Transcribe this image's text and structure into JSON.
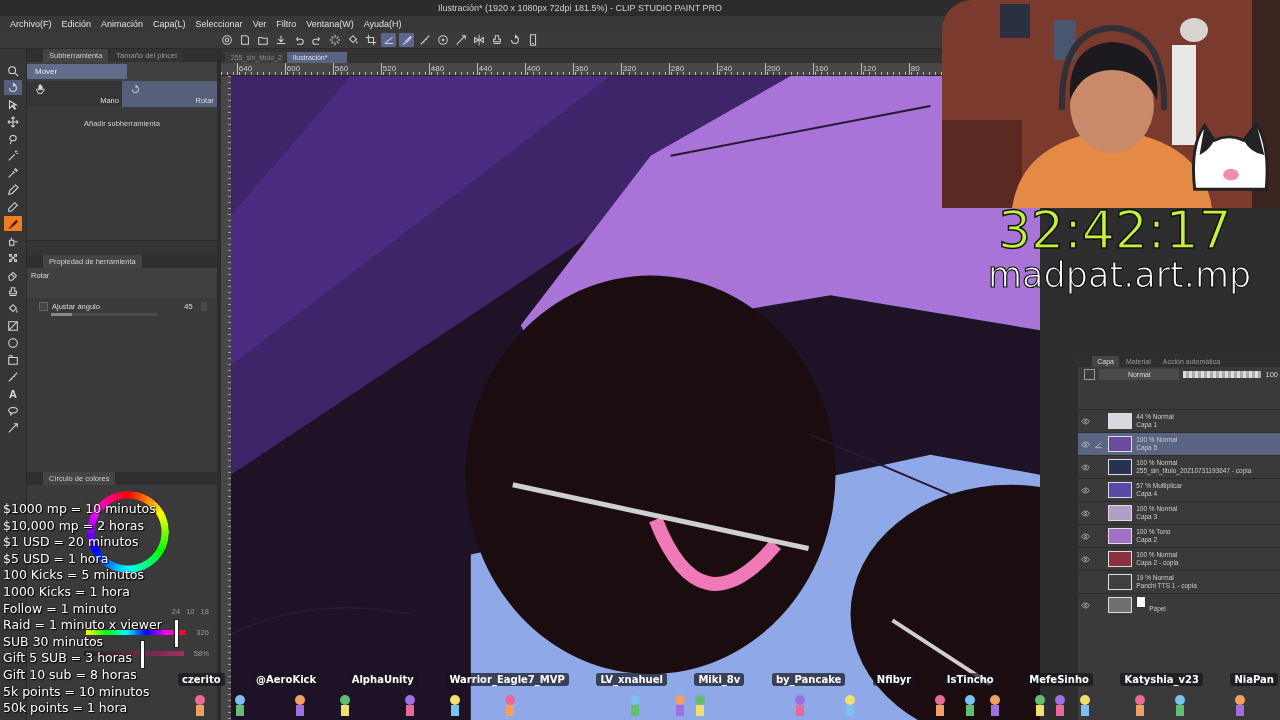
{
  "window": {
    "title": "Ilustración* (1920 x 1080px 72dpi 181.5%)  - CLIP STUDIO PAINT PRO"
  },
  "menu": [
    "Archivo(F)",
    "Edición",
    "Animación",
    "Capa(L)",
    "Seleccionar",
    "Ver",
    "Filtro",
    "Ventana(W)",
    "Ayuda(H)"
  ],
  "toolbar": [
    {
      "kind": "navigator",
      "on": false
    },
    {
      "kind": "new",
      "on": false
    },
    {
      "kind": "open",
      "on": false
    },
    {
      "kind": "save",
      "on": false
    },
    {
      "kind": "undo",
      "on": false
    },
    {
      "kind": "redo",
      "on": false
    },
    {
      "kind": "deselect",
      "on": false
    },
    {
      "kind": "fill",
      "on": false
    },
    {
      "kind": "crop",
      "on": false
    },
    {
      "kind": "snap",
      "on": true
    },
    {
      "kind": "brush",
      "on": true
    },
    {
      "kind": "ruler",
      "on": false
    },
    {
      "kind": "help",
      "on": false
    },
    {
      "kind": "correction",
      "on": false
    },
    {
      "kind": "flip",
      "on": false
    },
    {
      "kind": "stamp",
      "on": false
    },
    {
      "kind": "rotate",
      "on": false
    },
    {
      "kind": "device",
      "on": false
    }
  ],
  "tools": [
    {
      "kind": "zoom",
      "selected": false,
      "marked": false
    },
    {
      "kind": "rotate",
      "selected": true,
      "marked": false
    },
    {
      "kind": "select",
      "selected": false,
      "marked": false
    },
    {
      "kind": "move",
      "selected": false,
      "marked": false
    },
    {
      "kind": "lasso",
      "selected": false,
      "marked": false
    },
    {
      "kind": "wand",
      "selected": false,
      "marked": false
    },
    {
      "kind": "eyedropper",
      "selected": false,
      "marked": false
    },
    {
      "kind": "pen",
      "selected": false,
      "marked": false
    },
    {
      "kind": "pencil",
      "selected": false,
      "marked": false
    },
    {
      "kind": "brush",
      "selected": false,
      "marked": true
    },
    {
      "kind": "airbrush",
      "selected": false,
      "marked": false
    },
    {
      "kind": "decoration",
      "selected": false,
      "marked": false
    },
    {
      "kind": "eraser",
      "selected": false,
      "marked": false
    },
    {
      "kind": "stamp",
      "selected": false,
      "marked": false
    },
    {
      "kind": "fill",
      "selected": false,
      "marked": false
    },
    {
      "kind": "gradient",
      "selected": false,
      "marked": false
    },
    {
      "kind": "shape",
      "selected": false,
      "marked": false
    },
    {
      "kind": "frame",
      "selected": false,
      "marked": false
    },
    {
      "kind": "ruler",
      "selected": false,
      "marked": false
    },
    {
      "kind": "text",
      "glyph": "A",
      "selected": false,
      "marked": false
    },
    {
      "kind": "balloon",
      "selected": false,
      "marked": false
    },
    {
      "kind": "correction",
      "selected": false,
      "marked": false
    }
  ],
  "subtool_panel": {
    "tabs": [
      {
        "label": "Subherramienta",
        "selected": true
      },
      {
        "label": "Tamaño del pincel",
        "selected": false
      }
    ],
    "group": {
      "label": "Mover",
      "selected": true
    },
    "subtools": [
      {
        "label": "Mano",
        "kind": "hand",
        "selected": false
      },
      {
        "label": "Rotar",
        "kind": "rotate",
        "selected": true
      }
    ],
    "add_label": "Añadir subherramienta"
  },
  "tool_property": {
    "tab": "Propiedad de herramienta",
    "tool": "Rotar",
    "option": {
      "label": "Ajustar ángulo",
      "checked": false,
      "value": "45",
      "level": 0.2
    }
  },
  "color_panel": {
    "tab": "Círculo de colores",
    "rgb": [
      "24",
      "10",
      "18"
    ],
    "hue": {
      "reading": "326",
      "level": 0.9
    },
    "saturation": {
      "reading": "58%",
      "level": 0.58
    }
  },
  "documents": [
    {
      "label": "255_sin_titulo_2",
      "selected": false
    },
    {
      "label": "Ilustración*",
      "selected": true
    }
  ],
  "ruler": [
    "640",
    "600",
    "560",
    "520",
    "480",
    "440",
    "400",
    "360",
    "320",
    "280",
    "240",
    "200",
    "160",
    "120",
    "80"
  ],
  "layers_panel": {
    "tabs": [
      {
        "label": "Capa",
        "selected": true
      },
      {
        "label": "Material",
        "selected": false
      },
      {
        "label": "Acción automática",
        "selected": false
      }
    ],
    "blend": "Normal",
    "opacity": {
      "level": 1,
      "reading": "100"
    },
    "layers": [
      {
        "mode": "44 % Normal",
        "name": "Capa 1",
        "kind": "raster",
        "color": "#d8d8e0",
        "visible": true,
        "selected": false
      },
      {
        "mode": "100 % Normal",
        "name": "Capa 5",
        "kind": "raster",
        "color": "#6a4aa0",
        "visible": true,
        "selected": true
      },
      {
        "mode": "100 % Normal",
        "name": "255_sin_titulo_20210731193647 - copia",
        "kind": "raster",
        "color": "#2a3050",
        "visible": true,
        "selected": false
      },
      {
        "mode": "57 % Multiplicar",
        "name": "Capa 4",
        "kind": "raster",
        "color": "#5848a8",
        "visible": true,
        "selected": false
      },
      {
        "mode": "100 % Normal",
        "name": "Capa 3",
        "kind": "raster",
        "color": "#b0a0c8",
        "visible": true,
        "selected": false
      },
      {
        "mode": "100 % Tono",
        "name": "Capa 2",
        "kind": "raster",
        "color": "#a070c8",
        "visible": true,
        "selected": false
      },
      {
        "mode": "100 % Normal",
        "name": "Capa 2 - copia",
        "kind": "raster",
        "color": "#8a3040",
        "visible": true,
        "selected": false
      },
      {
        "mode": "19 % Normal",
        "name": "Panchi TTS 1 - copia",
        "kind": "raster",
        "color": "#404040",
        "visible": false,
        "selected": false
      },
      {
        "name": "Papel",
        "kind": "paper",
        "color": "#707070",
        "visible": true,
        "selected": false
      }
    ]
  },
  "stream": {
    "timer": "32:42:17",
    "handle": "madpat.art.mp",
    "rewards": [
      "$1000 mp = 10 minutos",
      "$10,000 mp = 2 horas",
      "$1 USD = 20 minutos",
      "$5 USD = 1 hora",
      "100 Kicks = 5 minutos",
      "1000 Kicks = 1 hora",
      "Follow = 1 minuto",
      "Raid = 1 minuto x viewer",
      "SUB 30 minutos",
      "Gift 5 SUB = 3 horas",
      "Gift 10 sub = 8 horas",
      "5k points = 10 minutos",
      "50k points = 1 hora"
    ],
    "viewers": [
      "czerito",
      "@AeroKick",
      "AlphaUnity",
      "Warrior_Eagle7_MVP",
      "LV_xnahuel",
      "Miki_8v",
      "by_Pancake",
      "Nfibyr",
      "IsTincho",
      "MefeSinho",
      "Katyshia_v23",
      "NiaPan"
    ]
  }
}
